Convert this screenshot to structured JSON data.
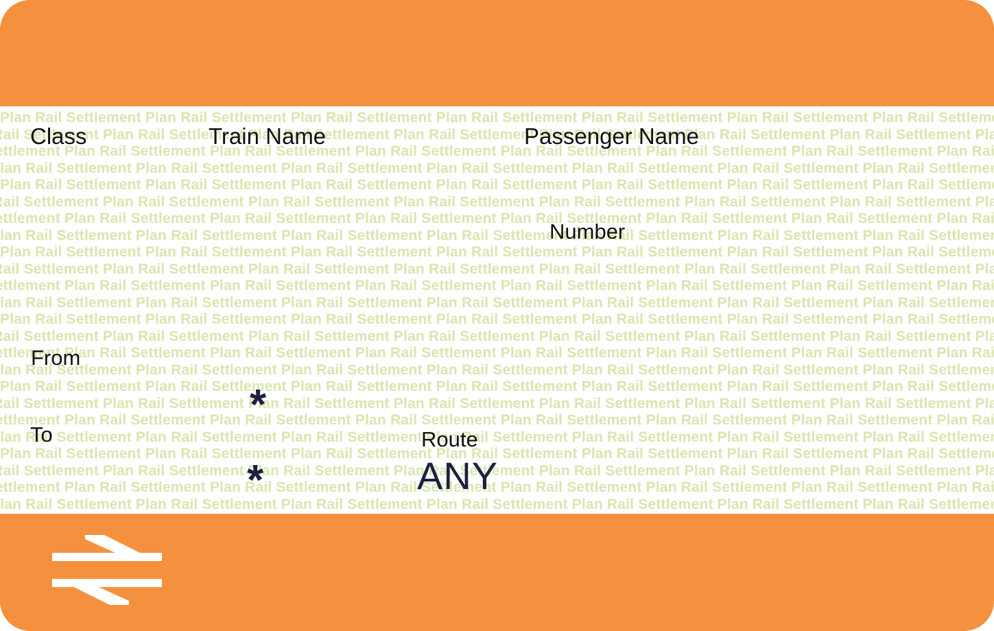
{
  "ticket": {
    "colors": {
      "orange": "#f5913e",
      "security_text": "#d9e6b0",
      "label_text": "#111111",
      "value_text": "#1d1f40"
    },
    "labels": {
      "class": "Class",
      "train_name": "Train Name",
      "passenger_name": "Passenger Name",
      "number": "Number",
      "from": "From",
      "to": "To",
      "route": "Route"
    },
    "values": {
      "from": "*",
      "to": "*",
      "route": "ANY"
    },
    "security_text": "Plan Rail Settlement Plan Rail Settlement Plan Rail Settlement Plan Rail Settlement Plan Rail Settlement Plan Rail Settlement Plan Rail Settlement Plan Rail Settlement",
    "logo_icon": "national-rail-double-arrow-icon"
  }
}
